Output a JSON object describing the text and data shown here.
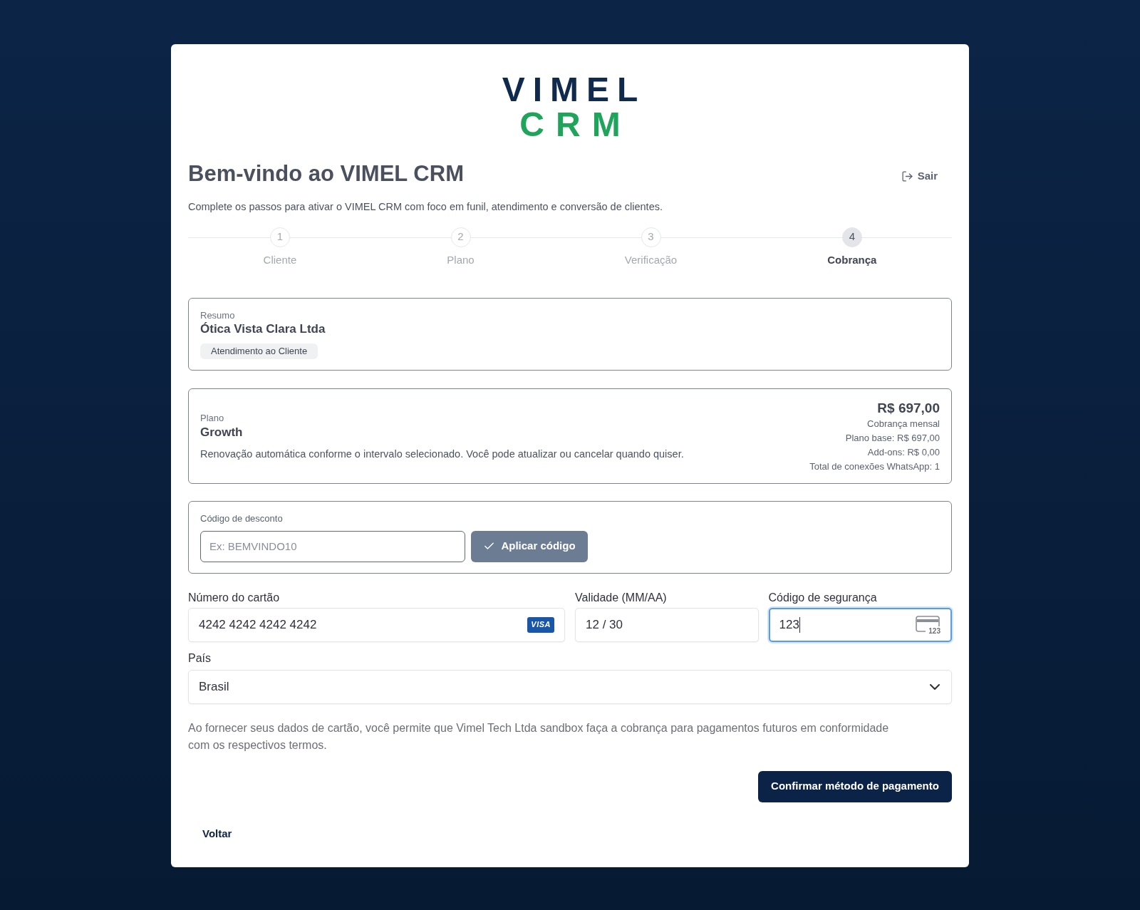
{
  "logo": {
    "line_1": "VIMEL",
    "line_2": "CRM"
  },
  "header": {
    "title": "Bem-vindo ao VIMEL CRM",
    "logout_label": "Sair",
    "subtitle": "Complete os passos para ativar o VIMEL CRM com foco em funil, atendimento e conversão de clientes."
  },
  "stepper": [
    {
      "number": "1",
      "label": "Cliente",
      "selected": false
    },
    {
      "number": "2",
      "label": "Plano",
      "selected": false
    },
    {
      "number": "3",
      "label": "Verificação",
      "selected": false
    },
    {
      "number": "4",
      "label": "Cobrança",
      "selected": true
    }
  ],
  "summary": {
    "label": "Resumo",
    "company": "Ótica Vista Clara Ltda",
    "tag": "Atendimento ao Cliente"
  },
  "plan": {
    "label": "Plano",
    "name": "Growth",
    "description": "Renovação automática conforme o intervalo selecionado. Você pode atualizar ou cancelar quando quiser.",
    "price": "R$ 697,00",
    "details": [
      "Cobrança mensal",
      "Plano base: R$ 697,00",
      "Add-ons: R$ 0,00",
      "Total de conexões WhatsApp: 1"
    ]
  },
  "discount": {
    "label": "Código de desconto",
    "placeholder": "Ex: BEMVINDO10",
    "button": "Aplicar código"
  },
  "payment": {
    "fields": [
      {
        "kind": "card_number",
        "label": "Número do cartão",
        "value": "4242 4242 4242 4242",
        "brand": "VISA",
        "focused": false
      },
      {
        "kind": "expiry",
        "label": "Validade (MM/AA)",
        "value": "12 / 30",
        "focused": false
      },
      {
        "kind": "cvc",
        "label": "Código de segurança",
        "value": "123",
        "icon_text": "123",
        "focused": true
      }
    ],
    "country": {
      "label": "País",
      "value": "Brasil"
    }
  },
  "disclaimer": "Ao fornecer seus dados de cartão, você permite que Vimel Tech Ltda sandbox faça a cobrança para pagamentos futuros em conformidade com os respectivos termos.",
  "confirm_button": "Confirmar método de pagamento",
  "back_button": "Voltar"
}
